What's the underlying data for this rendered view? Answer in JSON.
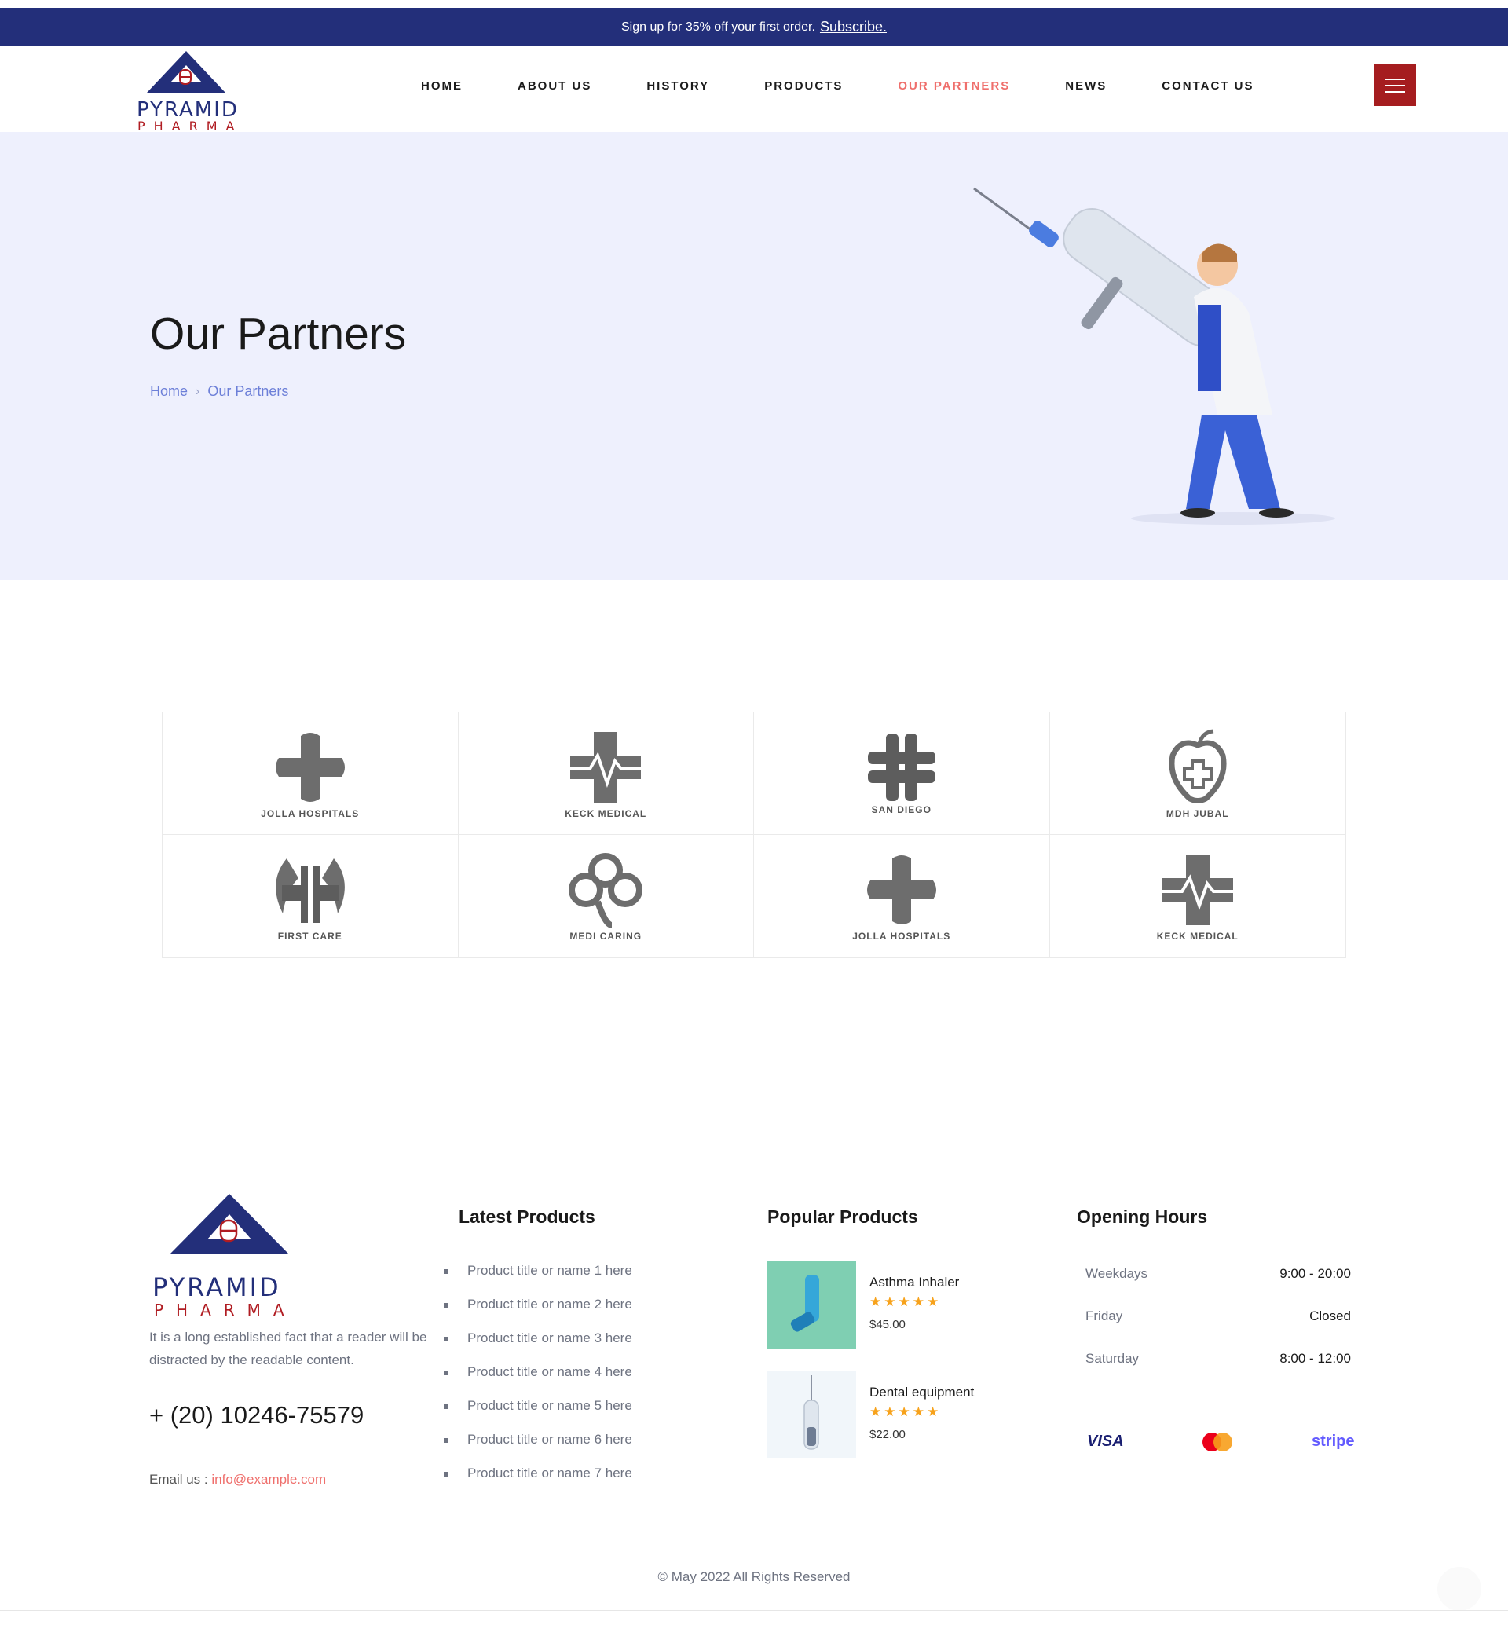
{
  "promo": {
    "text": "Sign up for 35% off your first order.",
    "link": "Subscribe."
  },
  "brand": {
    "line1": "PYRAMID",
    "line2": "PHARMA"
  },
  "nav": [
    {
      "label": "HOME"
    },
    {
      "label": "ABOUT US"
    },
    {
      "label": "HISTORY"
    },
    {
      "label": "PRODUCTS"
    },
    {
      "label": "OUR PARTNERS",
      "active": true
    },
    {
      "label": "NEWS"
    },
    {
      "label": "CONTACT US"
    }
  ],
  "hero": {
    "title": "Our Partners",
    "breadcrumb": [
      "Home",
      "Our Partners"
    ]
  },
  "partners": [
    {
      "name": "JOLLA HOSPITALS",
      "icon": "rounded-cross-icon"
    },
    {
      "name": "KECK MEDICAL",
      "icon": "heartbeat-cross-icon"
    },
    {
      "name": "SAN DIEGO",
      "icon": "split-cross-icon"
    },
    {
      "name": "MDH JUBAL",
      "icon": "apple-cross-icon"
    },
    {
      "name": "FIRST CARE",
      "icon": "wings-cross-icon"
    },
    {
      "name": "MEDI CARING",
      "icon": "clover-cross-icon"
    },
    {
      "name": "JOLLA HOSPITALS",
      "icon": "rounded-cross-icon"
    },
    {
      "name": "KECK MEDICAL",
      "icon": "heartbeat-cross-icon"
    }
  ],
  "footer": {
    "about": "It is a long established fact that a reader will be distracted by the readable content.",
    "phone": "+ (20) 10246-75579",
    "email_label": "Email us :",
    "email": "info@example.com",
    "latest_title": "Latest Products",
    "latest": [
      "Product title or name 1 here",
      "Product title or name 2 here",
      "Product title or name 3 here",
      "Product title or name 4 here",
      "Product title or name 5 here",
      "Product title or name 6 here",
      "Product title or name 7 here"
    ],
    "popular_title": "Popular Products",
    "popular": [
      {
        "name": "Asthma Inhaler",
        "stars": "★★★★★",
        "rating": 5,
        "price": "$45.00"
      },
      {
        "name": "Dental equipment",
        "stars": "★★★★★",
        "rating": 5,
        "price": "$22.00"
      }
    ],
    "hours_title": "Opening Hours",
    "hours": [
      {
        "day": "Weekdays",
        "time": "9:00 - 20:00"
      },
      {
        "day": "Friday",
        "time": "Closed"
      },
      {
        "day": "Saturday",
        "time": "8:00 - 12:00"
      }
    ],
    "payments": {
      "visa": "VISA",
      "stripe": "stripe"
    },
    "copyright": "© May 2022 All Rights Reserved"
  },
  "colors": {
    "navy": "#232f7a",
    "accent": "#ef6f6c",
    "menu": "#a51d1f",
    "hero_bg": "#eef0fd",
    "star": "#f7a21b"
  }
}
